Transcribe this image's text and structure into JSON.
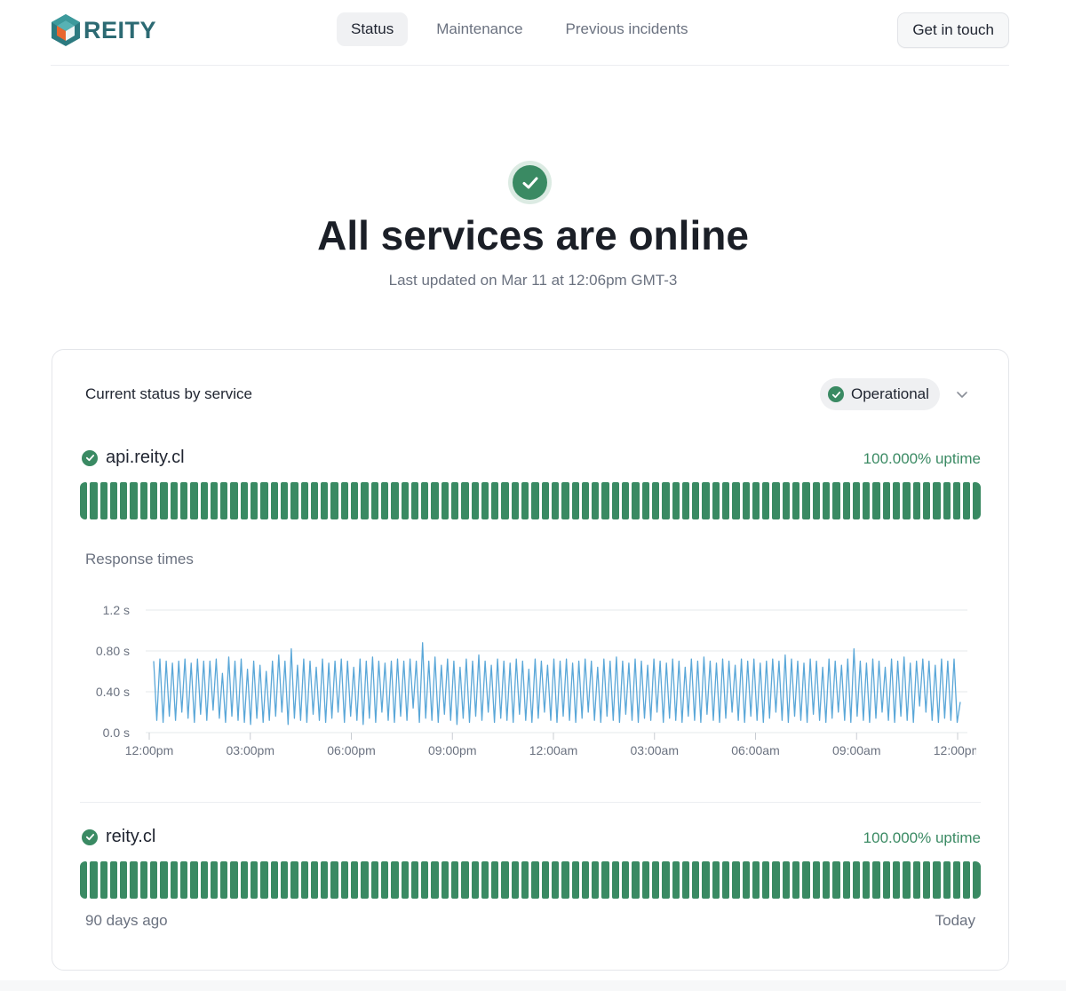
{
  "brand": {
    "name": "REITY"
  },
  "nav": {
    "items": [
      {
        "label": "Status",
        "active": true
      },
      {
        "label": "Maintenance",
        "active": false
      },
      {
        "label": "Previous incidents",
        "active": false
      }
    ],
    "contact_label": "Get in touch"
  },
  "hero": {
    "title": "All services are online",
    "subtitle": "Last updated on Mar 11 at 12:06pm GMT-3"
  },
  "card": {
    "title": "Current status by service",
    "status_filter": "Operational",
    "services": [
      {
        "name": "api.reity.cl",
        "uptime": "100.000% uptime",
        "status": "operational",
        "days": 90
      },
      {
        "name": "reity.cl",
        "uptime": "100.000% uptime",
        "status": "operational",
        "days": 90
      }
    ],
    "response_title": "Response times",
    "range_start": "90 days ago",
    "range_end": "Today"
  },
  "colors": {
    "ok": "#3a8a63",
    "line": "#5aa7d8",
    "brand": "#2c6a73"
  },
  "chart_data": {
    "type": "line",
    "ylabel": "",
    "yticks": [
      "0.0 s",
      "0.40 s",
      "0.80 s",
      "1.2 s"
    ],
    "ylim": [
      0,
      1.2
    ],
    "xticks": [
      "12:00pm",
      "03:00pm",
      "06:00pm",
      "09:00pm",
      "12:00am",
      "03:00am",
      "06:00am",
      "09:00am",
      "12:00pm"
    ],
    "series": [
      {
        "values": [
          0.7,
          0.12,
          0.72,
          0.1,
          0.7,
          0.16,
          0.68,
          0.12,
          0.7,
          0.2,
          0.72,
          0.14,
          0.68,
          0.1,
          0.72,
          0.18,
          0.7,
          0.12,
          0.7,
          0.22,
          0.72,
          0.14,
          0.58,
          0.1,
          0.74,
          0.16,
          0.7,
          0.12,
          0.72,
          0.1,
          0.62,
          0.08,
          0.7,
          0.14,
          0.66,
          0.1,
          0.6,
          0.12,
          0.7,
          0.16,
          0.76,
          0.2,
          0.7,
          0.08,
          0.82,
          0.14,
          0.66,
          0.12,
          0.72,
          0.1,
          0.7,
          0.18,
          0.64,
          0.12,
          0.72,
          0.1,
          0.68,
          0.14,
          0.7,
          0.2,
          0.72,
          0.1,
          0.7,
          0.16,
          0.64,
          0.12,
          0.72,
          0.08,
          0.7,
          0.14,
          0.74,
          0.1,
          0.7,
          0.2,
          0.68,
          0.12,
          0.7,
          0.1,
          0.72,
          0.16,
          0.7,
          0.12,
          0.72,
          0.24,
          0.7,
          0.1,
          0.88,
          0.14,
          0.7,
          0.12,
          0.74,
          0.1,
          0.66,
          0.18,
          0.72,
          0.12,
          0.7,
          0.08,
          0.64,
          0.14,
          0.72,
          0.1,
          0.7,
          0.16,
          0.76,
          0.12,
          0.7,
          0.2,
          0.66,
          0.1,
          0.72,
          0.14,
          0.7,
          0.12,
          0.68,
          0.1,
          0.72,
          0.18,
          0.7,
          0.12,
          0.62,
          0.1,
          0.72,
          0.14,
          0.7,
          0.2,
          0.66,
          0.12,
          0.72,
          0.1,
          0.7,
          0.16,
          0.72,
          0.12,
          0.68,
          0.1,
          0.7,
          0.14,
          0.72,
          0.2,
          0.7,
          0.12,
          0.64,
          0.1,
          0.72,
          0.16,
          0.7,
          0.12,
          0.74,
          0.1,
          0.7,
          0.18,
          0.68,
          0.12,
          0.72,
          0.1,
          0.7,
          0.14,
          0.66,
          0.12,
          0.72,
          0.2,
          0.7,
          0.1,
          0.68,
          0.14,
          0.72,
          0.12,
          0.7,
          0.1,
          0.64,
          0.16,
          0.72,
          0.12,
          0.7,
          0.1,
          0.74,
          0.18,
          0.7,
          0.12,
          0.68,
          0.1,
          0.72,
          0.14,
          0.7,
          0.2,
          0.66,
          0.12,
          0.72,
          0.1,
          0.7,
          0.16,
          0.72,
          0.12,
          0.68,
          0.1,
          0.7,
          0.14,
          0.72,
          0.2,
          0.7,
          0.12,
          0.76,
          0.1,
          0.72,
          0.16,
          0.7,
          0.12,
          0.68,
          0.1,
          0.72,
          0.18,
          0.7,
          0.12,
          0.64,
          0.1,
          0.72,
          0.14,
          0.7,
          0.2,
          0.66,
          0.12,
          0.72,
          0.1,
          0.82,
          0.16,
          0.7,
          0.12,
          0.68,
          0.1,
          0.72,
          0.14,
          0.7,
          0.2,
          0.64,
          0.12,
          0.72,
          0.1,
          0.7,
          0.16,
          0.74,
          0.12,
          0.68,
          0.1,
          0.7,
          0.26,
          0.72,
          0.2,
          0.7,
          0.12,
          0.66,
          0.1,
          0.72,
          0.14,
          0.7,
          0.12,
          0.72,
          0.1,
          0.3
        ]
      }
    ]
  }
}
